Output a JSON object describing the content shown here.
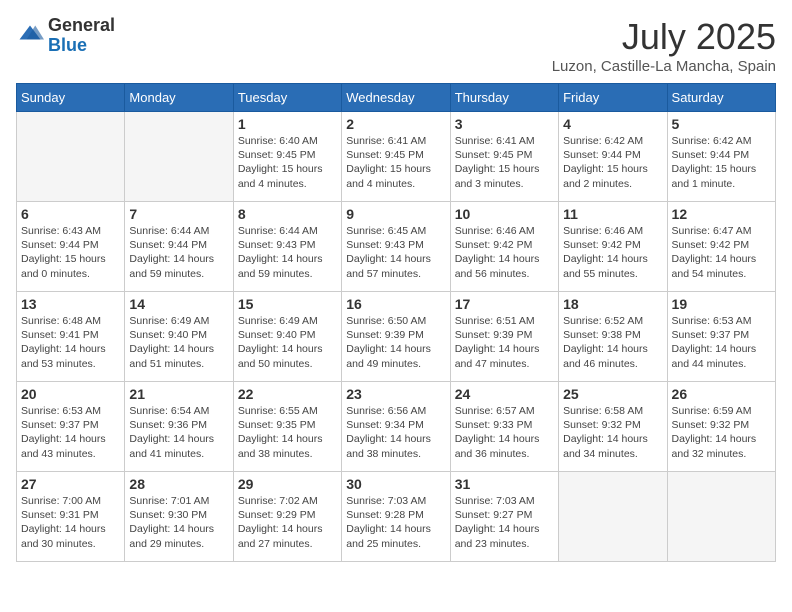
{
  "header": {
    "logo_general": "General",
    "logo_blue": "Blue",
    "month_year": "July 2025",
    "location": "Luzon, Castille-La Mancha, Spain"
  },
  "days_of_week": [
    "Sunday",
    "Monday",
    "Tuesday",
    "Wednesday",
    "Thursday",
    "Friday",
    "Saturday"
  ],
  "weeks": [
    [
      {
        "day": "",
        "info": ""
      },
      {
        "day": "",
        "info": ""
      },
      {
        "day": "1",
        "info": "Sunrise: 6:40 AM\nSunset: 9:45 PM\nDaylight: 15 hours\nand 4 minutes."
      },
      {
        "day": "2",
        "info": "Sunrise: 6:41 AM\nSunset: 9:45 PM\nDaylight: 15 hours\nand 4 minutes."
      },
      {
        "day": "3",
        "info": "Sunrise: 6:41 AM\nSunset: 9:45 PM\nDaylight: 15 hours\nand 3 minutes."
      },
      {
        "day": "4",
        "info": "Sunrise: 6:42 AM\nSunset: 9:44 PM\nDaylight: 15 hours\nand 2 minutes."
      },
      {
        "day": "5",
        "info": "Sunrise: 6:42 AM\nSunset: 9:44 PM\nDaylight: 15 hours\nand 1 minute."
      }
    ],
    [
      {
        "day": "6",
        "info": "Sunrise: 6:43 AM\nSunset: 9:44 PM\nDaylight: 15 hours\nand 0 minutes."
      },
      {
        "day": "7",
        "info": "Sunrise: 6:44 AM\nSunset: 9:44 PM\nDaylight: 14 hours\nand 59 minutes."
      },
      {
        "day": "8",
        "info": "Sunrise: 6:44 AM\nSunset: 9:43 PM\nDaylight: 14 hours\nand 59 minutes."
      },
      {
        "day": "9",
        "info": "Sunrise: 6:45 AM\nSunset: 9:43 PM\nDaylight: 14 hours\nand 57 minutes."
      },
      {
        "day": "10",
        "info": "Sunrise: 6:46 AM\nSunset: 9:42 PM\nDaylight: 14 hours\nand 56 minutes."
      },
      {
        "day": "11",
        "info": "Sunrise: 6:46 AM\nSunset: 9:42 PM\nDaylight: 14 hours\nand 55 minutes."
      },
      {
        "day": "12",
        "info": "Sunrise: 6:47 AM\nSunset: 9:42 PM\nDaylight: 14 hours\nand 54 minutes."
      }
    ],
    [
      {
        "day": "13",
        "info": "Sunrise: 6:48 AM\nSunset: 9:41 PM\nDaylight: 14 hours\nand 53 minutes."
      },
      {
        "day": "14",
        "info": "Sunrise: 6:49 AM\nSunset: 9:40 PM\nDaylight: 14 hours\nand 51 minutes."
      },
      {
        "day": "15",
        "info": "Sunrise: 6:49 AM\nSunset: 9:40 PM\nDaylight: 14 hours\nand 50 minutes."
      },
      {
        "day": "16",
        "info": "Sunrise: 6:50 AM\nSunset: 9:39 PM\nDaylight: 14 hours\nand 49 minutes."
      },
      {
        "day": "17",
        "info": "Sunrise: 6:51 AM\nSunset: 9:39 PM\nDaylight: 14 hours\nand 47 minutes."
      },
      {
        "day": "18",
        "info": "Sunrise: 6:52 AM\nSunset: 9:38 PM\nDaylight: 14 hours\nand 46 minutes."
      },
      {
        "day": "19",
        "info": "Sunrise: 6:53 AM\nSunset: 9:37 PM\nDaylight: 14 hours\nand 44 minutes."
      }
    ],
    [
      {
        "day": "20",
        "info": "Sunrise: 6:53 AM\nSunset: 9:37 PM\nDaylight: 14 hours\nand 43 minutes."
      },
      {
        "day": "21",
        "info": "Sunrise: 6:54 AM\nSunset: 9:36 PM\nDaylight: 14 hours\nand 41 minutes."
      },
      {
        "day": "22",
        "info": "Sunrise: 6:55 AM\nSunset: 9:35 PM\nDaylight: 14 hours\nand 38 minutes."
      },
      {
        "day": "23",
        "info": "Sunrise: 6:56 AM\nSunset: 9:34 PM\nDaylight: 14 hours\nand 38 minutes."
      },
      {
        "day": "24",
        "info": "Sunrise: 6:57 AM\nSunset: 9:33 PM\nDaylight: 14 hours\nand 36 minutes."
      },
      {
        "day": "25",
        "info": "Sunrise: 6:58 AM\nSunset: 9:32 PM\nDaylight: 14 hours\nand 34 minutes."
      },
      {
        "day": "26",
        "info": "Sunrise: 6:59 AM\nSunset: 9:32 PM\nDaylight: 14 hours\nand 32 minutes."
      }
    ],
    [
      {
        "day": "27",
        "info": "Sunrise: 7:00 AM\nSunset: 9:31 PM\nDaylight: 14 hours\nand 30 minutes."
      },
      {
        "day": "28",
        "info": "Sunrise: 7:01 AM\nSunset: 9:30 PM\nDaylight: 14 hours\nand 29 minutes."
      },
      {
        "day": "29",
        "info": "Sunrise: 7:02 AM\nSunset: 9:29 PM\nDaylight: 14 hours\nand 27 minutes."
      },
      {
        "day": "30",
        "info": "Sunrise: 7:03 AM\nSunset: 9:28 PM\nDaylight: 14 hours\nand 25 minutes."
      },
      {
        "day": "31",
        "info": "Sunrise: 7:03 AM\nSunset: 9:27 PM\nDaylight: 14 hours\nand 23 minutes."
      },
      {
        "day": "",
        "info": ""
      },
      {
        "day": "",
        "info": ""
      }
    ]
  ]
}
